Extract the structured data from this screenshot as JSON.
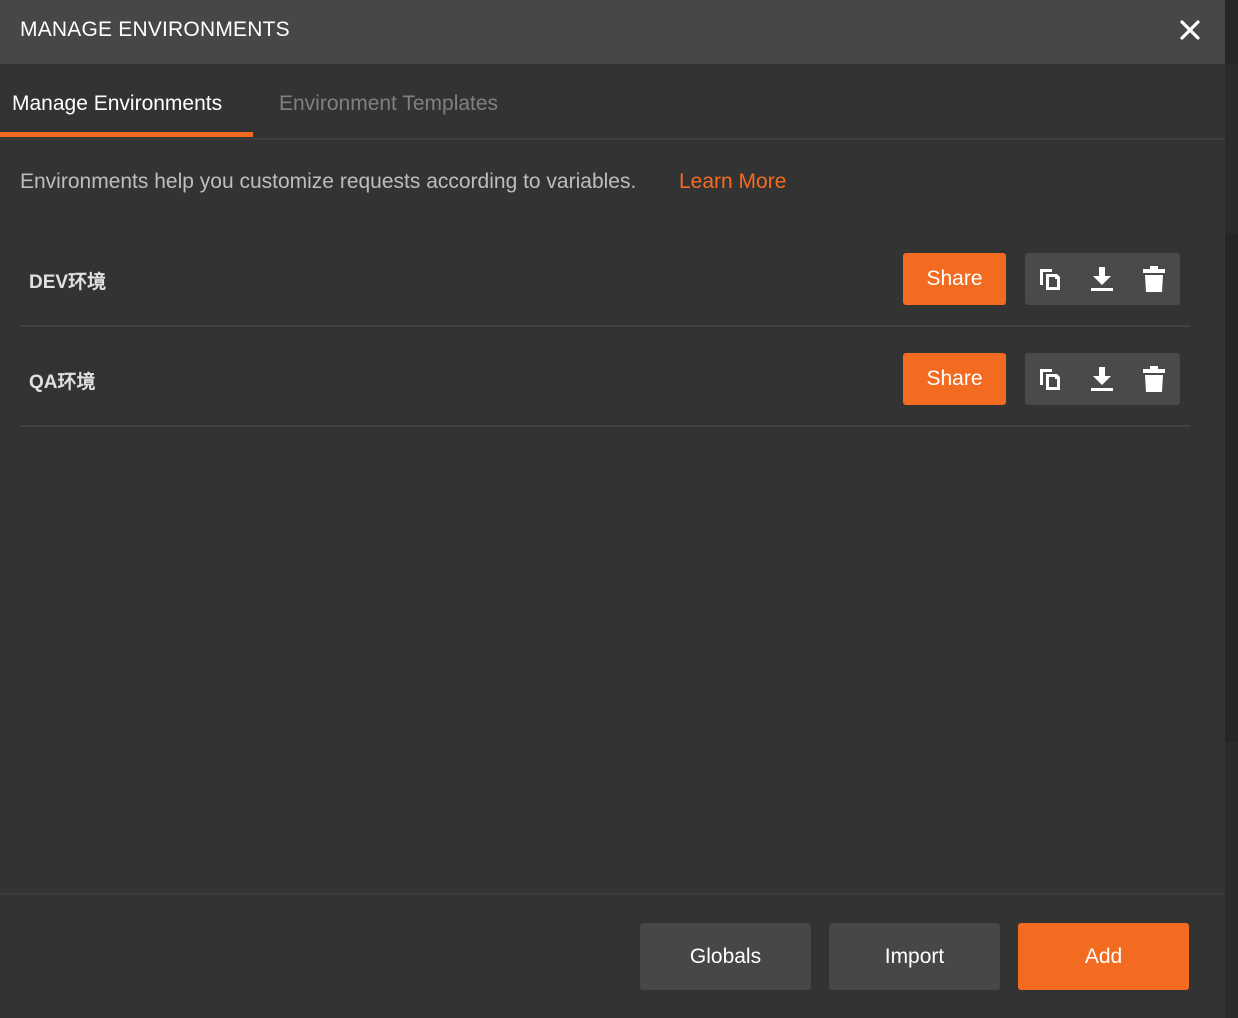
{
  "header": {
    "title": "MANAGE ENVIRONMENTS",
    "close_icon": "close-icon"
  },
  "tabs": [
    {
      "label": "Manage Environments",
      "active": true
    },
    {
      "label": "Environment Templates",
      "active": false
    }
  ],
  "description": {
    "text": "Environments help you customize requests according to variables.",
    "link": "Learn More"
  },
  "environments": [
    {
      "name": "DEV环境",
      "share_label": "Share"
    },
    {
      "name": "QA环境",
      "share_label": "Share"
    }
  ],
  "icons": {
    "duplicate": "duplicate-icon",
    "download": "download-icon",
    "delete": "trash-icon"
  },
  "footer": {
    "globals_label": "Globals",
    "import_label": "Import",
    "add_label": "Add"
  },
  "colors": {
    "accent": "#f26b21",
    "header_bg": "#474747",
    "panel_bg": "#333333"
  }
}
